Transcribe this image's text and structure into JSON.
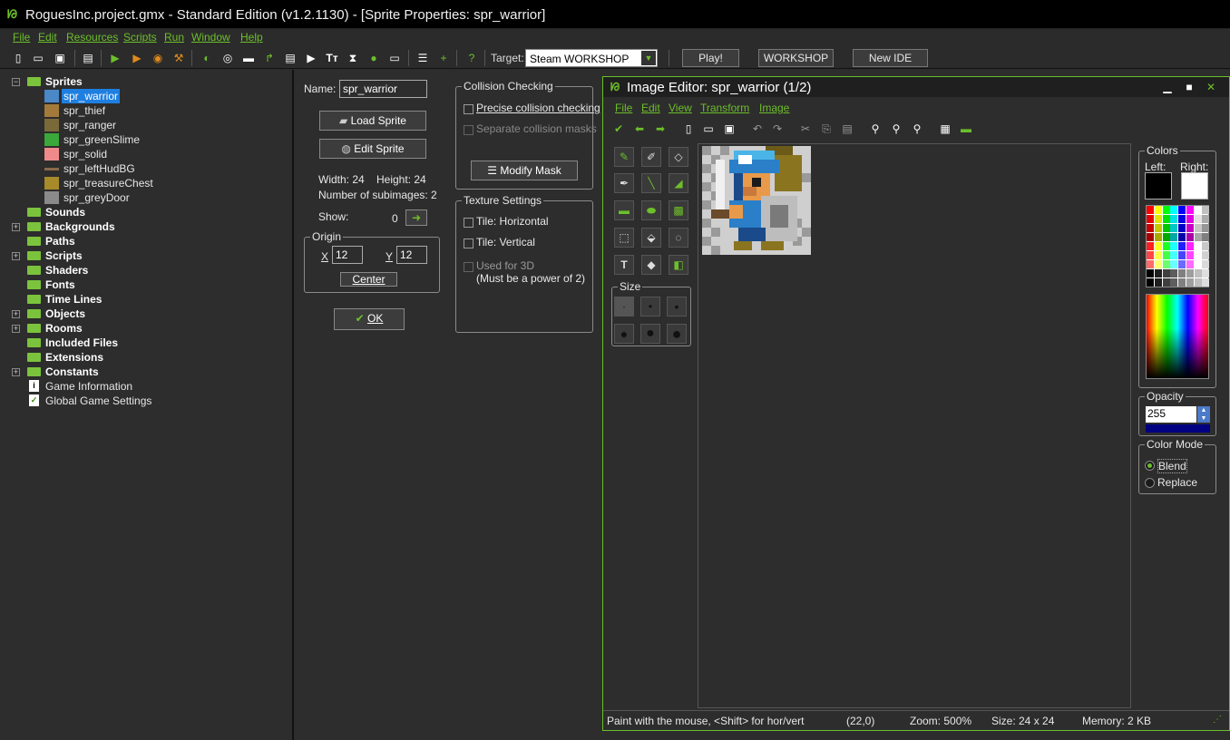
{
  "window": {
    "title": "RoguesInc.project.gmx  -  Standard Edition (v1.2.1130) - [Sprite Properties: spr_warrior]"
  },
  "menu": [
    "File",
    "Edit",
    "Resources",
    "Scripts",
    "Run",
    "Window",
    "Help"
  ],
  "toolbar": {
    "target_label": "Target:",
    "target_value": "Steam WORKSHOP",
    "play_label": "Play!",
    "workshop_label": "WORKSHOP",
    "new_ide_label": "New IDE"
  },
  "tree": {
    "sprites_label": "Sprites",
    "sprites": [
      "spr_warrior",
      "spr_thief",
      "spr_ranger",
      "spr_greenSlime",
      "spr_solid",
      "spr_leftHudBG",
      "spr_treasureChest",
      "spr_greyDoor"
    ],
    "folders": [
      "Sounds",
      "Backgrounds",
      "Paths",
      "Scripts",
      "Shaders",
      "Fonts",
      "Time Lines",
      "Objects",
      "Rooms",
      "Included Files",
      "Extensions",
      "Constants"
    ],
    "game_info": "Game Information",
    "global_settings": "Global Game Settings"
  },
  "sprite_props": {
    "name_label": "Name:",
    "name_value": "spr_warrior",
    "load_sprite": "Load Sprite",
    "edit_sprite": "Edit Sprite",
    "width_text": "Width: 24",
    "height_text": "Height: 24",
    "subimages_text": "Number of subimages: 2",
    "show_label": "Show:",
    "show_value": "0",
    "origin_label": "Origin",
    "origin_x_label": "X",
    "origin_x": "12",
    "origin_y_label": "Y",
    "origin_y": "12",
    "center_label": "Center",
    "ok_label": "OK",
    "collision_label": "Collision Checking",
    "precise_label": "Precise collision checking",
    "separate_label": "Separate collision masks",
    "modify_mask": "Modify Mask",
    "texture_label": "Texture Settings",
    "tile_h": "Tile: Horizontal",
    "tile_v": "Tile: Vertical",
    "used_3d": "Used for 3D",
    "power_of_2": "(Must be a power of 2)"
  },
  "image_editor": {
    "title": "Image Editor: spr_warrior (1/2)",
    "menu": [
      "File",
      "Edit",
      "View",
      "Transform",
      "Image"
    ],
    "size_label": "Size",
    "colors_label": "Colors",
    "left_label": "Left:",
    "right_label": "Right:",
    "opacity_label": "Opacity",
    "opacity_value": "255",
    "color_mode_label": "Color Mode",
    "blend_label": "Blend",
    "replace_label": "Replace",
    "status": {
      "hint": "Paint with the mouse, <Shift> for hor/vert",
      "coords": "(22,0)",
      "zoom": "Zoom: 500%",
      "size": "Size: 24 x 24",
      "memory": "Memory: 2 KB"
    }
  },
  "colors": {
    "accent": "#6cbf2a",
    "selection": "#1e7fe0",
    "background": "#2d2d2d"
  }
}
